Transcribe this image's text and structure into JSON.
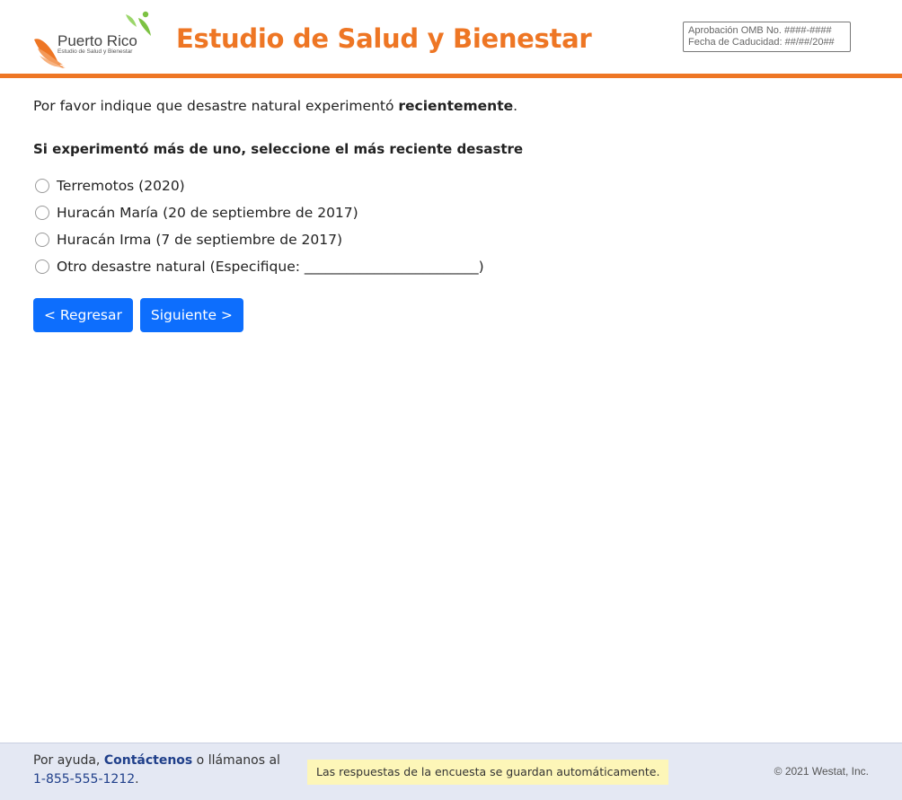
{
  "header": {
    "logo_text": "Puerto Rico",
    "logo_subtext": "Estudio de Salud y Bienestar",
    "title": "Estudio de Salud y Bienestar",
    "omb_line1": "Aprobación OMB No. ####-####",
    "omb_line2": "Fecha de Caducidad: ##/##/20##"
  },
  "question": {
    "intro_prefix": "Por favor indique que desastre natural experimentó ",
    "intro_bold": "recientemente",
    "intro_suffix": ".",
    "subtitle": "Si experimentó más de uno, seleccione el más reciente desastre",
    "options": [
      {
        "label": "Terremotos (2020)"
      },
      {
        "label": "Huracán María (20 de septiembre de 2017)"
      },
      {
        "label": "Huracán Irma (7 de septiembre de 2017)"
      },
      {
        "label": "Otro desastre natural (Especifique: _________________________)"
      }
    ]
  },
  "nav": {
    "back_label": "< Regresar",
    "next_label": "Siguiente >"
  },
  "footer": {
    "help_prefix": "Por ayuda, ",
    "contact_link": "Contáctenos",
    "help_middle": " o llámanos al",
    "phone": "1-855-555-1212",
    "phone_suffix": ".",
    "autosave_notice": "Las respuestas de la encuesta se guardan automáticamente.",
    "copyright": "© 2021 Westat, Inc."
  },
  "colors": {
    "brand_orange": "#ee7624",
    "button_blue": "#0d6efd",
    "footer_bg": "#e4e8f3",
    "notice_bg": "#fdf6b8"
  }
}
